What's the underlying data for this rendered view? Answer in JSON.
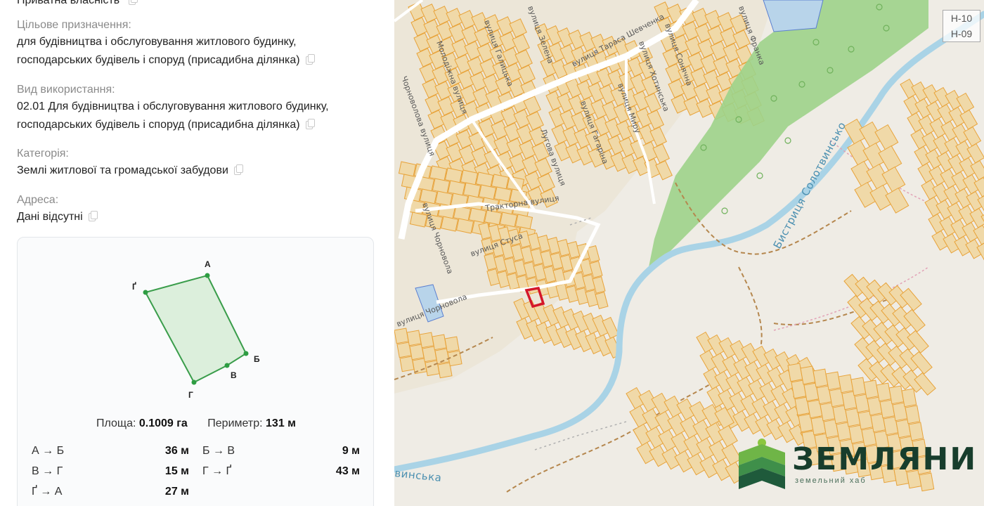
{
  "panel": {
    "ownership_value": "Приватна власність",
    "purpose": {
      "label": "Цільове призначення:",
      "line1": "для будівництва і обслуговування житлового будинку,",
      "line2": "господарських будівель і споруд (присадибна ділянка)"
    },
    "usage": {
      "label": "Вид використання:",
      "line1": "02.01 Для будівництва і обслуговування житлового будинку,",
      "line2": "господарських будівель і споруд (присадибна ділянка)"
    },
    "category": {
      "label": "Категорія:",
      "value": "Землі житлової та громадської забудови"
    },
    "address": {
      "label": "Адреса:",
      "value": "Дані відсутні"
    },
    "parcel": {
      "vertices": [
        "А",
        "Б",
        "В",
        "Г",
        "Ґ"
      ],
      "area_label": "Площа:",
      "area_value": "0.1009 га",
      "perimeter_label": "Периметр:",
      "perimeter_value": "131 м",
      "segments": [
        {
          "name": "А → Б",
          "length": "36 м"
        },
        {
          "name": "Б → В",
          "length": "9 м"
        },
        {
          "name": "В → Г",
          "length": "15 м"
        },
        {
          "name": "Г → Ґ",
          "length": "43 м"
        },
        {
          "name": "Ґ → А",
          "length": "27 м"
        }
      ],
      "colors": {
        "fill": "#dcefdc",
        "stroke": "#3a9d4b"
      }
    }
  },
  "map": {
    "streets": [
      "вулиця Тараса Шевченка",
      "Молодіжна вулиця",
      "вулиця Галицька",
      "вулиця Зелена",
      "вулиця Сонячна",
      "вулиця Хотинська",
      "вулиця Миру",
      "вулиця Гагаріна",
      "Лугова вулиця",
      "вулиця Франка",
      "Чорноволова вулиця",
      "вулиця Чорновола",
      "Тракторна вулиця",
      "вулиця Стуса",
      "вулиця Чорновола"
    ],
    "river_labels": [
      "Бистриця Солотвинсько",
      "винська"
    ],
    "sheet_labels": [
      "Н-10",
      "Н-09"
    ],
    "colors": {
      "parcel": "#f0d9a8",
      "parcel_border": "#e8a33a",
      "forest": "#9dd389",
      "water": "#a9d3e6",
      "highlight": "#d4172a"
    }
  },
  "logo": {
    "name": "ЗЕМЛЯНИ",
    "tagline": "земельний хаб",
    "color": "#173d2c"
  }
}
